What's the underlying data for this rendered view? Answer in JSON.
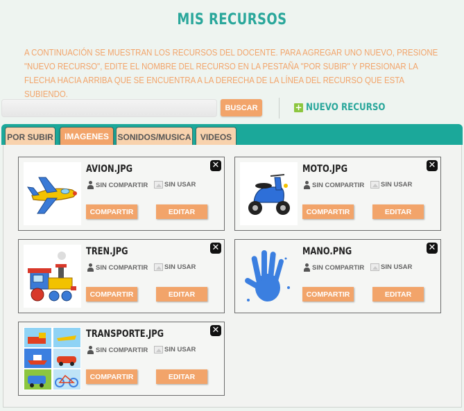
{
  "page": {
    "title": "MIS RECURSOS",
    "instructions": "A CONTINUACIÓN SE MUESTRAN LOS RECURSOS DEL DOCENTE. PARA AGREGAR UNO NUEVO, PRESIONE \"NUEVO RECURSO\", EDITE EL NOMBRE DEL RECURSO EN LA PESTAÑA \"POR SUBIR\" Y PRESIONAR LA FLECHA HACIA ARRIBA QUE SE ENCUENTRA A LA DERECHA DE LA LÍNEA DEL RECURSO QUE ESTA SUBIENDO."
  },
  "search": {
    "value": "",
    "button_label": "BUSCAR"
  },
  "new_resource": {
    "icon": "plus-icon",
    "label": "NUEVO RECURSO"
  },
  "tabs": [
    {
      "label": "POR SUBIR",
      "active": false
    },
    {
      "label": "IMAGENES",
      "active": true
    },
    {
      "label": "SONIDOS/MUSICA",
      "active": false
    },
    {
      "label": "VIDEOS",
      "active": false
    }
  ],
  "resources": [
    {
      "filename": "AVION.JPG",
      "thumbnail": "airplane",
      "share_status": "SIN COMPARTIR",
      "usage_status": "SIN USAR",
      "share_label": "COMPARTIR",
      "edit_label": "EDITAR",
      "close_symbol": "✕"
    },
    {
      "filename": "MOTO.JPG",
      "thumbnail": "scooter",
      "share_status": "SIN COMPARTIR",
      "usage_status": "SIN USAR",
      "share_label": "COMPARTIR",
      "edit_label": "EDITAR",
      "close_symbol": "✕"
    },
    {
      "filename": "TREN.JPG",
      "thumbnail": "train",
      "share_status": "SIN COMPARTIR",
      "usage_status": "SIN USAR",
      "share_label": "COMPARTIR",
      "edit_label": "EDITAR",
      "close_symbol": "✕"
    },
    {
      "filename": "MANO.PNG",
      "thumbnail": "hand-print",
      "share_status": "SIN COMPARTIR",
      "usage_status": "SIN USAR",
      "share_label": "COMPARTIR",
      "edit_label": "EDITAR",
      "close_symbol": "✕"
    },
    {
      "filename": "TRANSPORTE.JPG",
      "thumbnail": "transport-grid",
      "share_status": "SIN COMPARTIR",
      "usage_status": "SIN USAR",
      "share_label": "COMPARTIR",
      "edit_label": "EDITAR",
      "close_symbol": "✕"
    }
  ],
  "colors": {
    "accent": "#2aa79b",
    "orange": "#f2a46a",
    "tab_bar": "#1ba89a"
  }
}
